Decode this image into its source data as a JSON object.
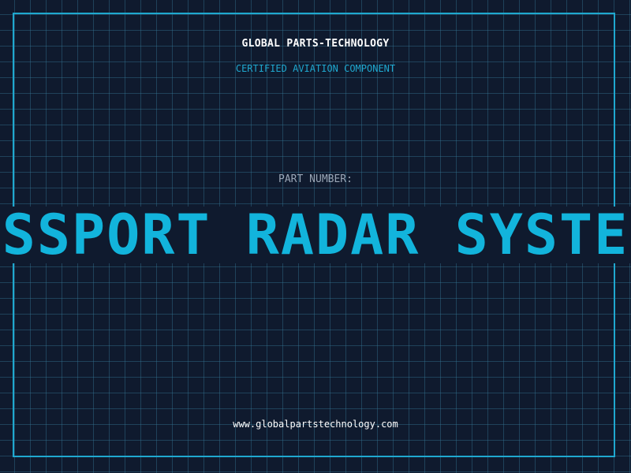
{
  "header": {
    "company": "GLOBAL PARTS-TECHNOLOGY",
    "subtitle": "CERTIFIED AVIATION COMPONENT"
  },
  "part": {
    "label": "PART NUMBER:",
    "number": "SSPORT RADAR SYSTE"
  },
  "footer": {
    "website": "www.globalpartstechnology.com"
  },
  "colors": {
    "background": "#0f1a2e",
    "accent": "#1fa8cf",
    "part_number": "#12b4dc",
    "label": "#9aa6b6"
  }
}
